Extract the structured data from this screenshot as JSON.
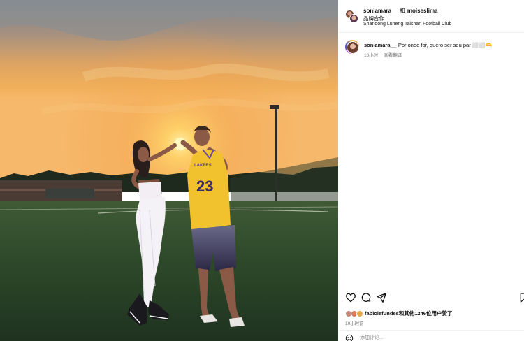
{
  "post": {
    "author": "soniamara__",
    "connector": "和",
    "coauthor": "moiseslima",
    "partnership_label": "品牌合作",
    "location": "Shandong Luneng Taishan Football Club"
  },
  "caption": {
    "author": "soniamara__",
    "text": "Por onde for, quero ser seu par ⬜⬜🫶",
    "time": "10小时",
    "translate_label": "查看翻译"
  },
  "actions": {
    "like": "heart-icon",
    "comment": "comment-bubble-icon",
    "share": "paper-plane-icon",
    "save": "bookmark-icon"
  },
  "likes": {
    "text": "fabiolefundes和其他1246位用户赞了",
    "avatar_colors": [
      "#c4877a",
      "#d97b5a",
      "#e6a84f"
    ]
  },
  "time_ago": "10小时前",
  "comment_box": {
    "placeholder": "添加评论...",
    "emoji_icon": "smiley-icon"
  },
  "photo": {
    "jersey_number": "23",
    "jersey_text": "LAKERS",
    "colors": {
      "jersey": "#f2c12e",
      "shorts": "#3b3560",
      "leggings": "#f4f2f6",
      "sky_top": "#8a8f95",
      "sun": "#ffe27a"
    }
  }
}
